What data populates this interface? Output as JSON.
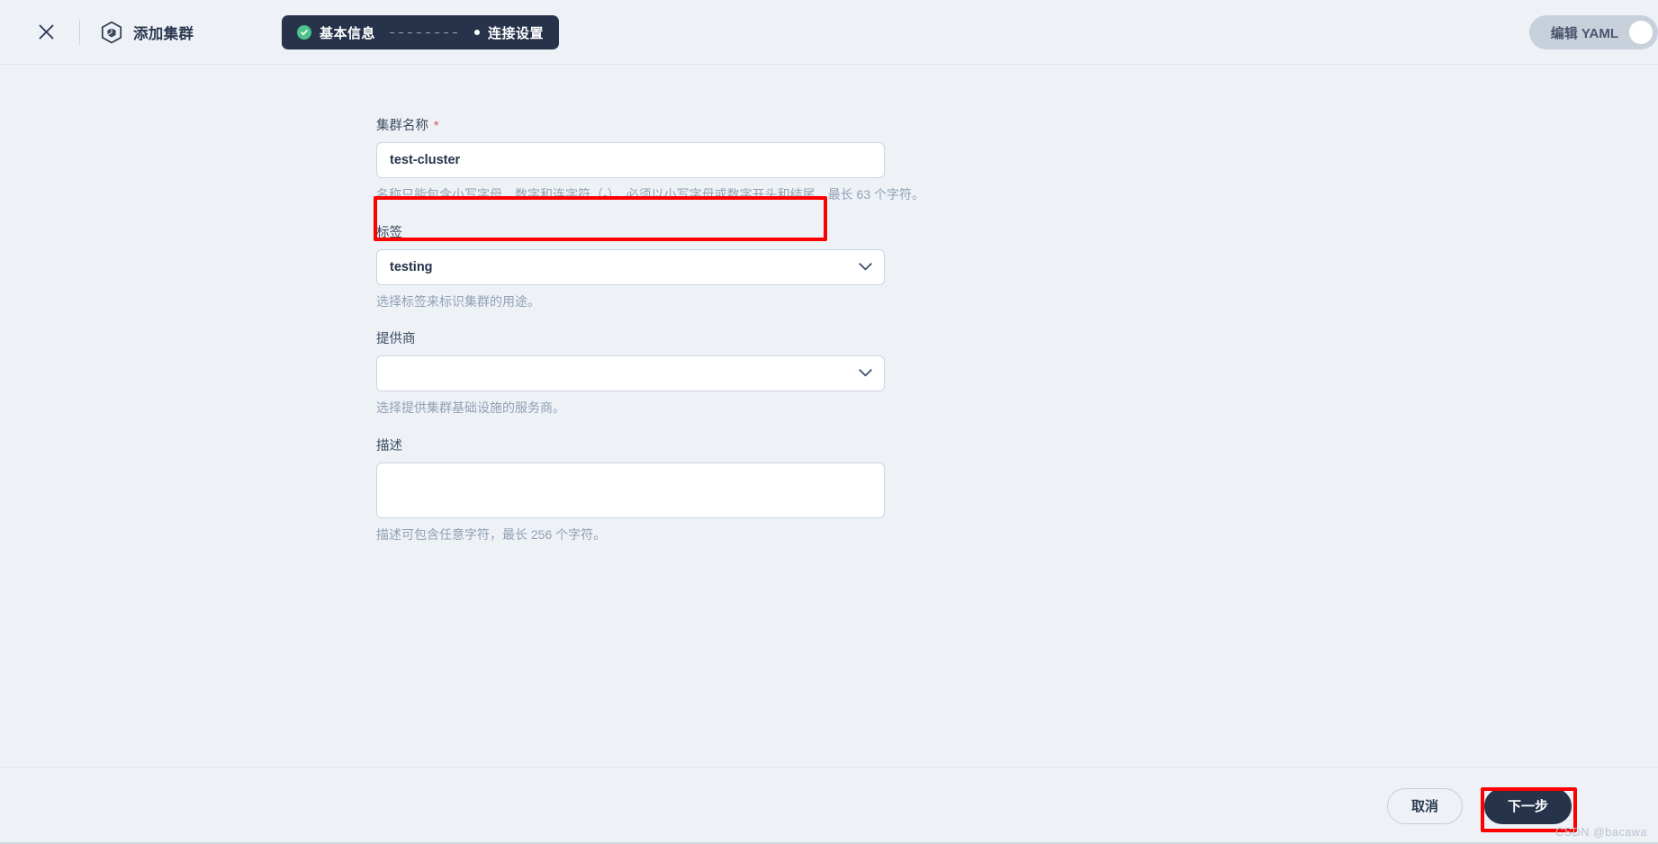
{
  "header": {
    "close_icon": "close-icon",
    "brand_icon": "hexagon-cube-icon",
    "brand_title": "添加集群",
    "yaml_toggle": {
      "label": "编辑 YAML",
      "state": "off"
    }
  },
  "stepper": {
    "steps": [
      {
        "label": "基本信息",
        "state": "completed",
        "icon": "check-circle-icon"
      },
      {
        "label": "连接设置",
        "state": "upcoming",
        "icon": "dot-icon"
      }
    ]
  },
  "form": {
    "fields": [
      {
        "key": "cluster_name",
        "label": "集群名称",
        "required": true,
        "required_marker": "*",
        "control": "text",
        "value": "test-cluster",
        "placeholder": "",
        "helper": "名称只能包含小写字母、数字和连字符（-），必须以小写字母或数字开头和结尾，最长 63 个字符。",
        "highlighted": true
      },
      {
        "key": "label",
        "label": "标签",
        "required": false,
        "required_marker": "",
        "control": "select",
        "value": "testing",
        "placeholder": "",
        "helper": "选择标签来标识集群的用途。",
        "highlighted": false
      },
      {
        "key": "provider",
        "label": "提供商",
        "required": false,
        "required_marker": "",
        "control": "select",
        "value": "",
        "placeholder": "",
        "helper": "选择提供集群基础设施的服务商。",
        "highlighted": false
      },
      {
        "key": "description",
        "label": "描述",
        "required": false,
        "required_marker": "",
        "control": "textarea",
        "value": "",
        "placeholder": "",
        "helper": "描述可包含任意字符，最长 256 个字符。",
        "highlighted": false
      }
    ]
  },
  "footer": {
    "cancel_label": "取消",
    "next_label": "下一步",
    "next_highlighted": true
  },
  "watermark": "CSDN @bacawa",
  "colors": {
    "page_background": "#eef2f7",
    "dark_navy": "#26334b",
    "accent_green": "#4cc38a",
    "annotation_red": "#ff0000",
    "required_red": "#e5484d",
    "border": "#ccd5e1",
    "helper_text": "#93a0b4"
  }
}
